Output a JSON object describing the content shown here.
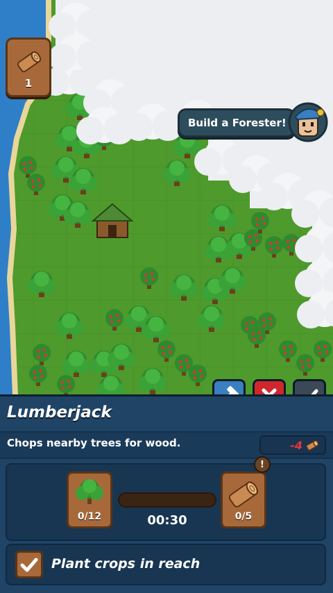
{
  "hud": {
    "wood_count": "1",
    "hint_text": "Build a Forester!"
  },
  "actions": {
    "build_icon": "hammer-icon",
    "cancel_icon": "close-icon",
    "confirm_icon": "check-icon"
  },
  "building": {
    "name": "Lumberjack",
    "description": "Chops nearby trees for wood.",
    "upkeep": "-4",
    "input_count": "0/12",
    "output_count": "0/5",
    "output_badge": "!",
    "timer": "00:30",
    "progress": 0,
    "option_label": "Plant crops in reach",
    "option_checked": true
  },
  "colors": {
    "grass": "#4e9a2c",
    "water": "#2f7fc8",
    "panel": "#1f4466",
    "wood": "#a8693a",
    "cancel_red": "#d0272f",
    "upkeep_red": "#e8353b"
  }
}
